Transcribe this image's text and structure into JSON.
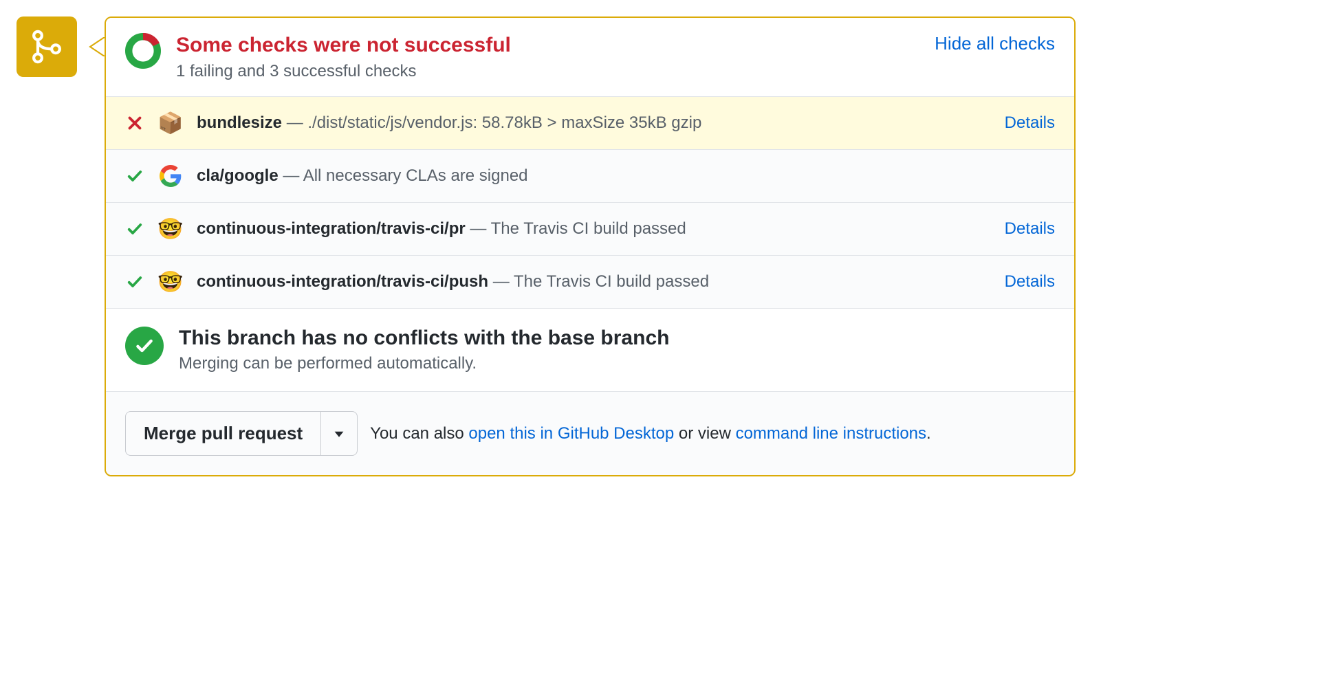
{
  "header": {
    "title": "Some checks were not successful",
    "subtitle": "1 failing and 3 successful checks",
    "hide_link": "Hide all checks"
  },
  "checks": [
    {
      "status": "fail",
      "icon_emoji": "📦",
      "name": "bundlesize",
      "desc": "./dist/static/js/vendor.js: 58.78kB > maxSize 35kB gzip",
      "details_label": "Details",
      "has_details": true
    },
    {
      "status": "pass",
      "icon_type": "google",
      "name": "cla/google",
      "desc": "All necessary CLAs are signed",
      "has_details": false
    },
    {
      "status": "pass",
      "icon_emoji": "🤓",
      "name": "continuous-integration/travis-ci/pr",
      "desc": "The Travis CI build passed",
      "details_label": "Details",
      "has_details": true
    },
    {
      "status": "pass",
      "icon_emoji": "🤓",
      "name": "continuous-integration/travis-ci/push",
      "desc": "The Travis CI build passed",
      "details_label": "Details",
      "has_details": true
    }
  ],
  "conflict": {
    "title": "This branch has no conflicts with the base branch",
    "subtitle": "Merging can be performed automatically."
  },
  "footer": {
    "merge_button": "Merge pull request",
    "prefix": "You can also ",
    "desktop_link": "open this in GitHub Desktop",
    "middle": " or view ",
    "cli_link": "command line instructions",
    "suffix": "."
  }
}
